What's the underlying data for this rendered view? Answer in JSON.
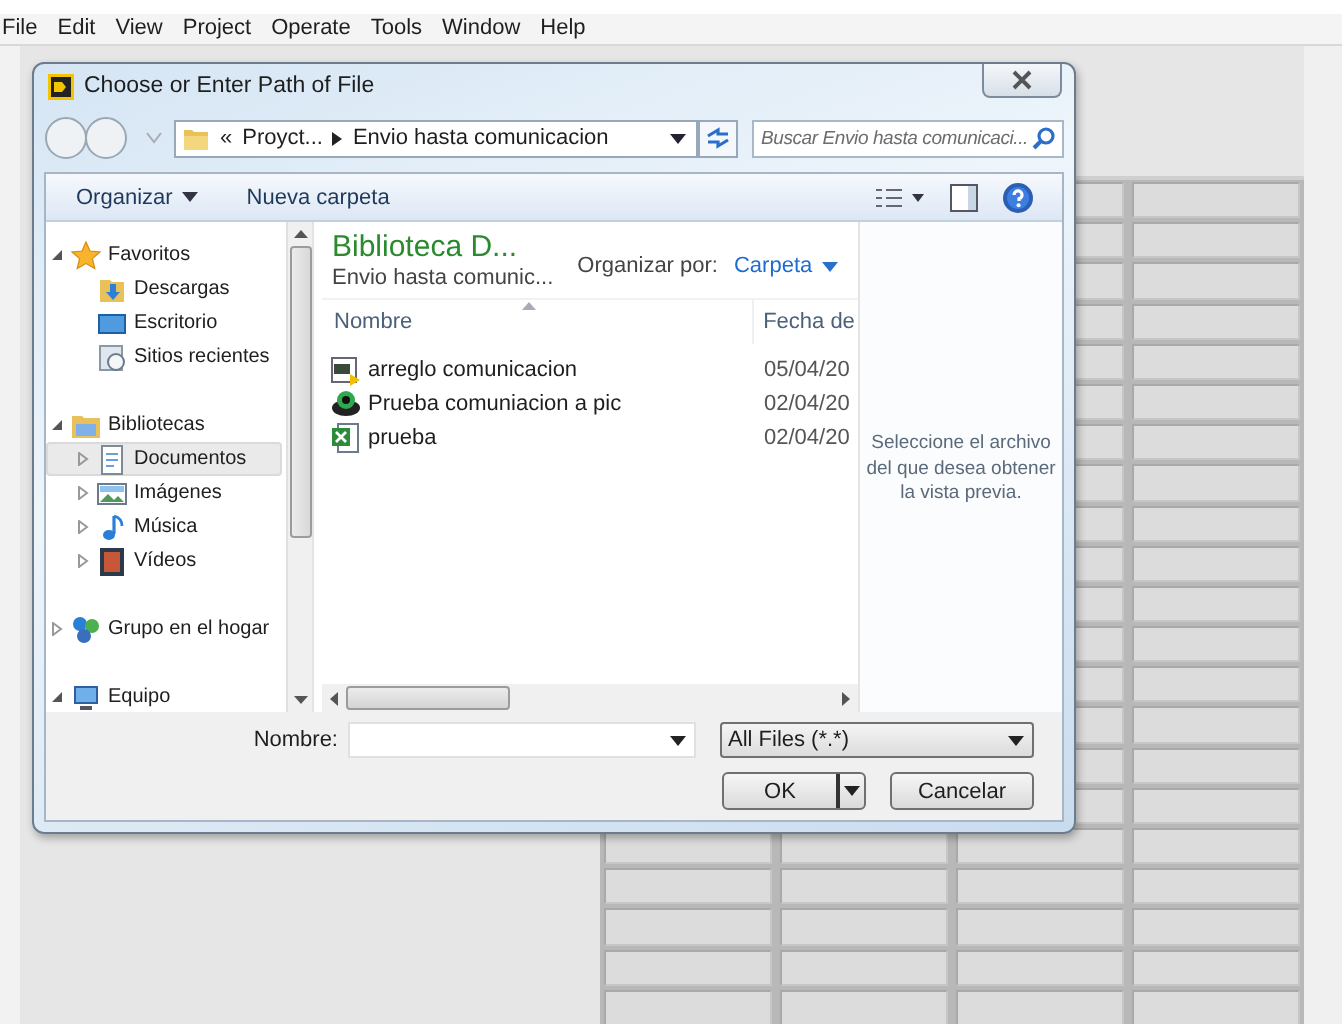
{
  "menu_bar": [
    "File",
    "Edit",
    "View",
    "Project",
    "Operate",
    "Tools",
    "Window",
    "Help"
  ],
  "dialog": {
    "title": "Choose or Enter Path of File",
    "address": {
      "overflow": "«",
      "segments": [
        "Proyct...",
        "Envio hasta comunicacion"
      ]
    },
    "search": {
      "placeholder": "Buscar Envio hasta comunicaci..."
    },
    "toolbar": {
      "organize": "Organizar",
      "new_folder": "Nueva carpeta"
    },
    "sidebar": [
      {
        "label": "Favoritos",
        "kind": "favorites",
        "expanded": true,
        "selected": false,
        "children": [
          {
            "label": "Descargas",
            "kind": "downloads",
            "selected": false
          },
          {
            "label": "Escritorio",
            "kind": "desktop",
            "selected": false
          },
          {
            "label": "Sitios recientes",
            "kind": "recent",
            "selected": false
          }
        ]
      },
      {
        "label": "Bibliotecas",
        "kind": "libraries",
        "expanded": true,
        "selected": false,
        "children": [
          {
            "label": "Documentos",
            "kind": "documents",
            "expanded": false,
            "selected": true
          },
          {
            "label": "Imágenes",
            "kind": "pictures",
            "expanded": false,
            "selected": false
          },
          {
            "label": "Música",
            "kind": "music",
            "expanded": false,
            "selected": false
          },
          {
            "label": "Vídeos",
            "kind": "videos",
            "expanded": false,
            "selected": false
          }
        ]
      },
      {
        "label": "Grupo en el hogar",
        "kind": "homegroup",
        "expanded": false,
        "selected": false
      },
      {
        "label": "Equipo",
        "kind": "computer",
        "expanded": true,
        "selected": false
      }
    ],
    "library": {
      "title": "Biblioteca D...",
      "subtitle": "Envio hasta comunic...",
      "arrange_label": "Organizar por:",
      "arrange_value": "Carpeta"
    },
    "columns": [
      "Nombre",
      "Fecha de"
    ],
    "files": [
      {
        "name": "arreglo comunicacion",
        "date": "05/04/20",
        "kind": "vi"
      },
      {
        "name": "Prueba comuniacion a pic",
        "date": "02/04/20",
        "kind": "project"
      },
      {
        "name": "prueba",
        "date": "02/04/20",
        "kind": "spreadsheet"
      }
    ],
    "preview_text": "Seleccione el archivo del que desea obtener la vista previa.",
    "file_name_label": "Nombre:",
    "file_type": "All Files (*.*)",
    "buttons": [
      "OK",
      "Cancelar"
    ]
  }
}
